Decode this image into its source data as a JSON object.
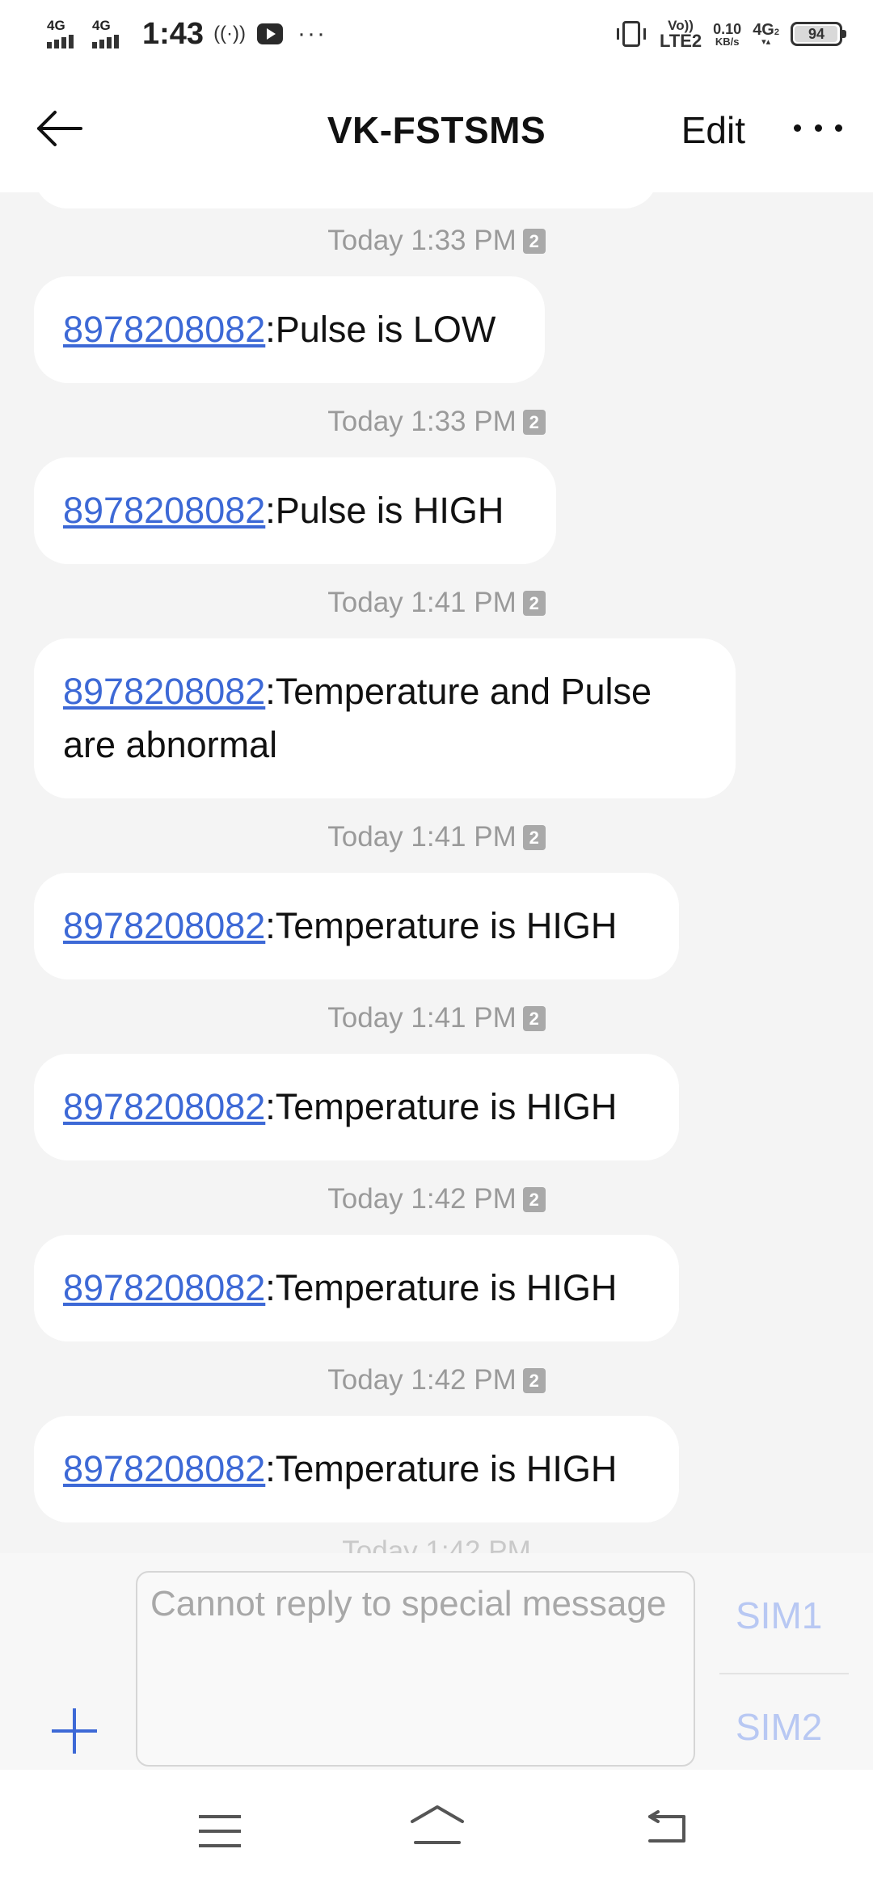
{
  "status_bar": {
    "network_1": "4G",
    "network_2": "4G",
    "time": "1:43",
    "hotspot": "((·))",
    "more": "···",
    "volte_top": "Vo))",
    "volte_bottom": "LTE2",
    "speed_value": "0.10",
    "speed_unit": "KB/s",
    "network_3": "4G",
    "network_3_sub": "2",
    "battery_level": "94"
  },
  "header": {
    "title": "VK-FSTSMS",
    "edit_label": "Edit"
  },
  "messages": [
    {
      "timestamp": "Today 1:33 PM",
      "sim": "2",
      "sender": "8978208082",
      "text": ":Pulse is LOW"
    },
    {
      "timestamp": "Today 1:33 PM",
      "sim": "2",
      "sender": "8978208082",
      "text": ":Pulse is HIGH"
    },
    {
      "timestamp": "Today 1:41 PM",
      "sim": "2",
      "sender": "8978208082",
      "text": ":Temperature and Pulse are abnormal"
    },
    {
      "timestamp": "Today 1:41 PM",
      "sim": "2",
      "sender": "8978208082",
      "text": ":Temperature is HIGH"
    },
    {
      "timestamp": "Today 1:41 PM",
      "sim": "2",
      "sender": "8978208082",
      "text": ":Temperature is HIGH"
    },
    {
      "timestamp": "Today 1:42 PM",
      "sim": "2",
      "sender": "8978208082",
      "text": ":Temperature is HIGH"
    },
    {
      "timestamp": "Today 1:42 PM",
      "sim": "2",
      "sender": "8978208082",
      "text": ":Temperature is HIGH"
    }
  ],
  "partial_timestamp": "Today 1:42 PM",
  "compose": {
    "placeholder": "Cannot reply to special message",
    "sim1_label": "SIM1",
    "sim2_label": "SIM2"
  },
  "colors": {
    "link": "#3d69d6",
    "background": "#f4f4f4",
    "bubble": "#ffffff",
    "sim_button": "#b8c8f3"
  },
  "icons": {
    "back": "arrow-left-icon",
    "more": "more-horizontal-icon",
    "add": "plus-icon",
    "nav_menu": "menu-icon",
    "nav_home": "home-icon",
    "nav_back": "back-icon"
  }
}
